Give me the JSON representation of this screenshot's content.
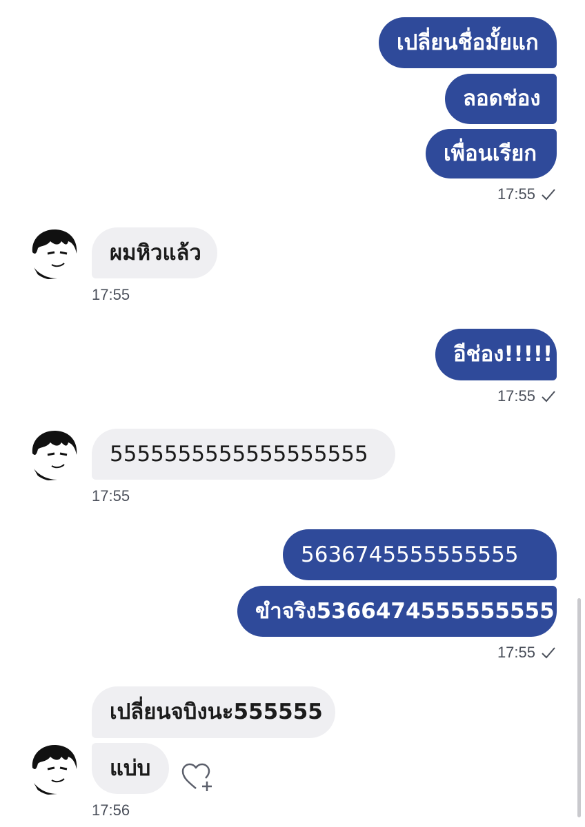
{
  "messages": {
    "m1": "เปลี่ยนชื่อมั้ยแก",
    "m2": "ลอดช่อง",
    "m3": "เพื่อนเรียก",
    "t1": "17:55",
    "m4": "ผมหิวแล้ว",
    "t2": "17:55",
    "m5": "อีช่อง!!!!!",
    "t3": "17:55",
    "m6": "5555555555555555555",
    "t4": "17:55",
    "m7": "5636745555555555",
    "m8": "ขำจริง5366474555555555",
    "t5": "17:55",
    "m9": "เปลี่ยนจบิงนะ555555",
    "m10": "แบ่บ",
    "t6": "17:56"
  },
  "colors": {
    "outgoing_bubble": "#2f4a9a",
    "incoming_bubble": "#efeff2",
    "timestamp": "#4a4f5a"
  },
  "icons": {
    "read_receipt": "checkmark-icon",
    "react": "heart-plus-icon"
  }
}
